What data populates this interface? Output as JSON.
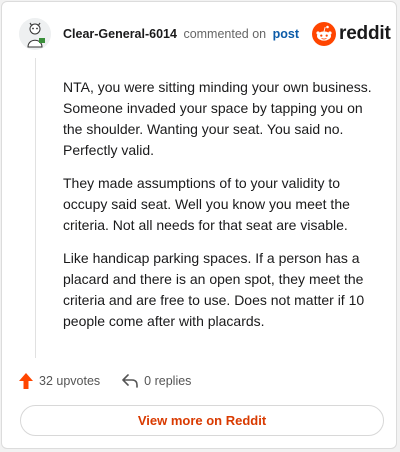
{
  "header": {
    "author": "Clear-General-6014",
    "verb": "commented on",
    "post_link": "post"
  },
  "logo": {
    "word": "reddit",
    "brand_color": "#ff4500",
    "icon": "reddit-snoo-icon"
  },
  "comment": {
    "paragraphs": [
      "NTA, you were sitting minding your own business. Someone invaded your space by tapping you on the shoulder. Wanting your seat. You said no. Perfectly valid.",
      "They made assumptions of to your validity to occupy said seat. Well you know you meet the criteria. Not all needs for that seat are visable.",
      "Like handicap parking spaces. If a person has a placard and there is an open spot, they meet the criteria and are free to use. Does not matter if 10 people come after with placards."
    ]
  },
  "actions": {
    "upvotes": "32 upvotes",
    "replies": "0 replies",
    "upvote_icon": "upvote-arrow-icon",
    "reply_icon": "reply-arrow-icon"
  },
  "footer": {
    "view_more": "View more on Reddit",
    "accent": "#d93a00"
  }
}
